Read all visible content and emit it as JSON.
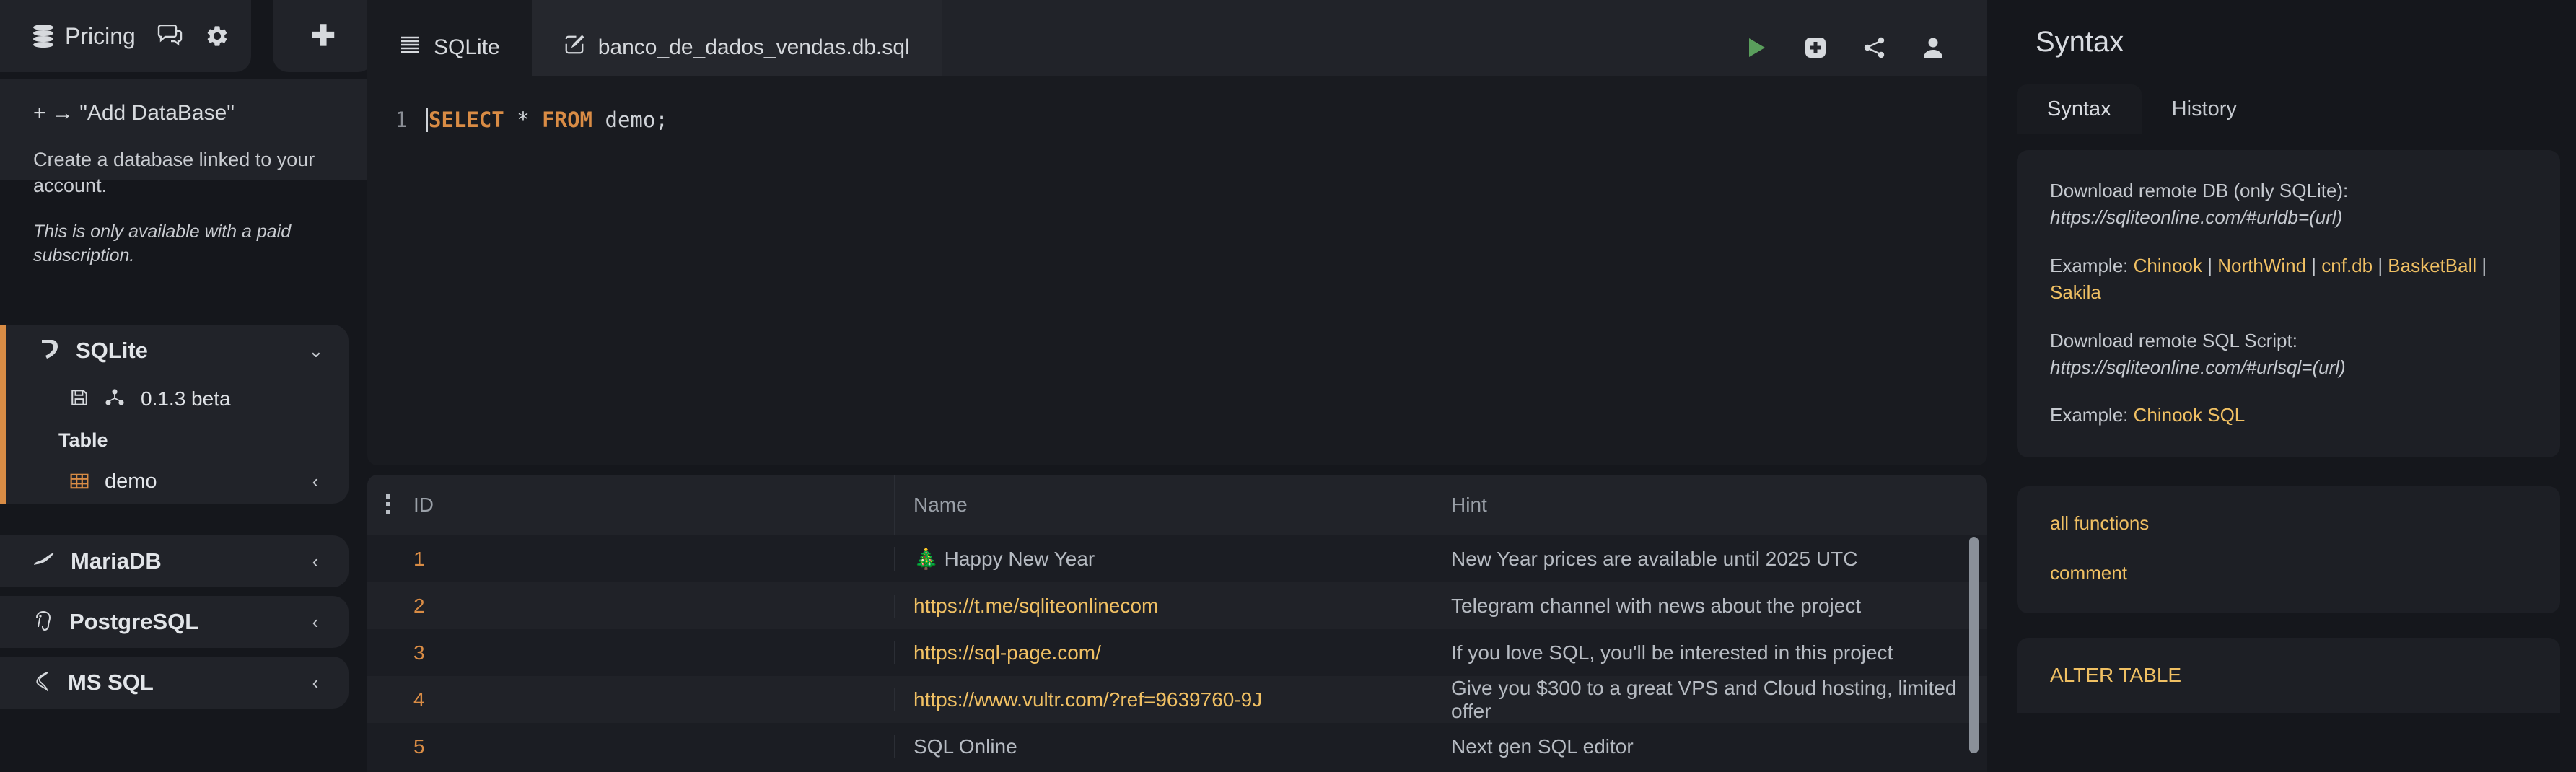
{
  "topbar": {
    "pricing_label": "Pricing",
    "db_icon": "database-stack-icon",
    "chat_icon": "chat-bubbles-icon",
    "settings_icon": "gear-icon",
    "add_icon": "plus-icon"
  },
  "sidebar": {
    "add_panel": {
      "title": "+ → \"Add DataBase\"",
      "description": "Create a database linked to your account.",
      "note": "This is only available with a paid subscription."
    },
    "databases": [
      {
        "name": "SQLite",
        "icon": "sqlite-feather-icon",
        "expanded": true,
        "chevron": "⌄",
        "version": "0.1.3 beta",
        "version_icons": [
          "save-disk-icon",
          "share-nodes-icon"
        ],
        "table_heading": "Table",
        "tables": [
          {
            "name": "demo",
            "icon": "table-grid-icon",
            "chevron": "‹"
          }
        ]
      },
      {
        "name": "MariaDB",
        "icon": "mariadb-seal-icon",
        "expanded": false,
        "chevron": "‹"
      },
      {
        "name": "PostgreSQL",
        "icon": "postgresql-elephant-icon",
        "expanded": false,
        "chevron": "‹"
      },
      {
        "name": "MS SQL",
        "icon": "mssql-server-icon",
        "expanded": false,
        "chevron": "‹"
      }
    ]
  },
  "editor": {
    "tabs": [
      {
        "label": "SQLite",
        "icon": "database-lines-icon",
        "active": false
      },
      {
        "label": "banco_de_dados_vendas.db.sql",
        "icon": "edit-pencil-icon",
        "active": true
      }
    ],
    "toolbar": [
      {
        "name": "run-query-button",
        "icon": "play-triangle-icon",
        "color": "#5a9e5c"
      },
      {
        "name": "add-query-button",
        "icon": "plus-square-icon",
        "color": "#d6d9dd"
      },
      {
        "name": "share-button",
        "icon": "share-nodes-icon",
        "color": "#d6d9dd"
      },
      {
        "name": "account-button",
        "icon": "user-icon",
        "color": "#d6d9dd"
      }
    ],
    "line_number": "1",
    "code": {
      "keyword1": "SELECT",
      "star": "*",
      "keyword2": "FROM",
      "identifier": "demo;"
    }
  },
  "results": {
    "columns": [
      "ID",
      "Name",
      "Hint"
    ],
    "rows": [
      {
        "id": "1",
        "name": "🎄 Happy New Year",
        "name_is_link": false,
        "hint": "New Year prices are available until 2025 UTC"
      },
      {
        "id": "2",
        "name": "https://t.me/sqliteonlinecom",
        "name_is_link": true,
        "hint": "Telegram channel with news about the project"
      },
      {
        "id": "3",
        "name": "https://sql-page.com/",
        "name_is_link": true,
        "hint": "If you love SQL, you'll be interested in this project"
      },
      {
        "id": "4",
        "name": "https://www.vultr.com/?ref=9639760-9J",
        "name_is_link": true,
        "hint": "Give you $300 to a great VPS and Cloud hosting, limited offer"
      },
      {
        "id": "5",
        "name": "SQL Online",
        "name_is_link": false,
        "hint": "Next gen SQL editor"
      }
    ]
  },
  "right_panel": {
    "title": "Syntax",
    "tabs": [
      {
        "label": "Syntax",
        "active": true
      },
      {
        "label": "History",
        "active": false
      }
    ],
    "info": {
      "download_db_label": "Download remote DB (only SQLite):",
      "download_db_url": "https://sqliteonline.com/#urldb=(url)",
      "example_db_label": "Example:",
      "example_db_links": [
        "Chinook",
        "NorthWind",
        "cnf.db",
        "BasketBall",
        "Sakila"
      ],
      "download_sql_label": "Download remote SQL Script:",
      "download_sql_url": "https://sqliteonline.com/#urlsql=(url)",
      "example_sql_label": "Example:",
      "example_sql_link": "Chinook SQL"
    },
    "functions": [
      "all functions",
      "comment"
    ],
    "sections": [
      "ALTER TABLE"
    ]
  },
  "colors": {
    "accent_orange": "#d98c45",
    "link_yellow": "#f0c063",
    "run_green": "#5a9e5c",
    "panel_bg": "#212329",
    "app_bg": "#15171c",
    "editor_bg": "#191b20"
  }
}
